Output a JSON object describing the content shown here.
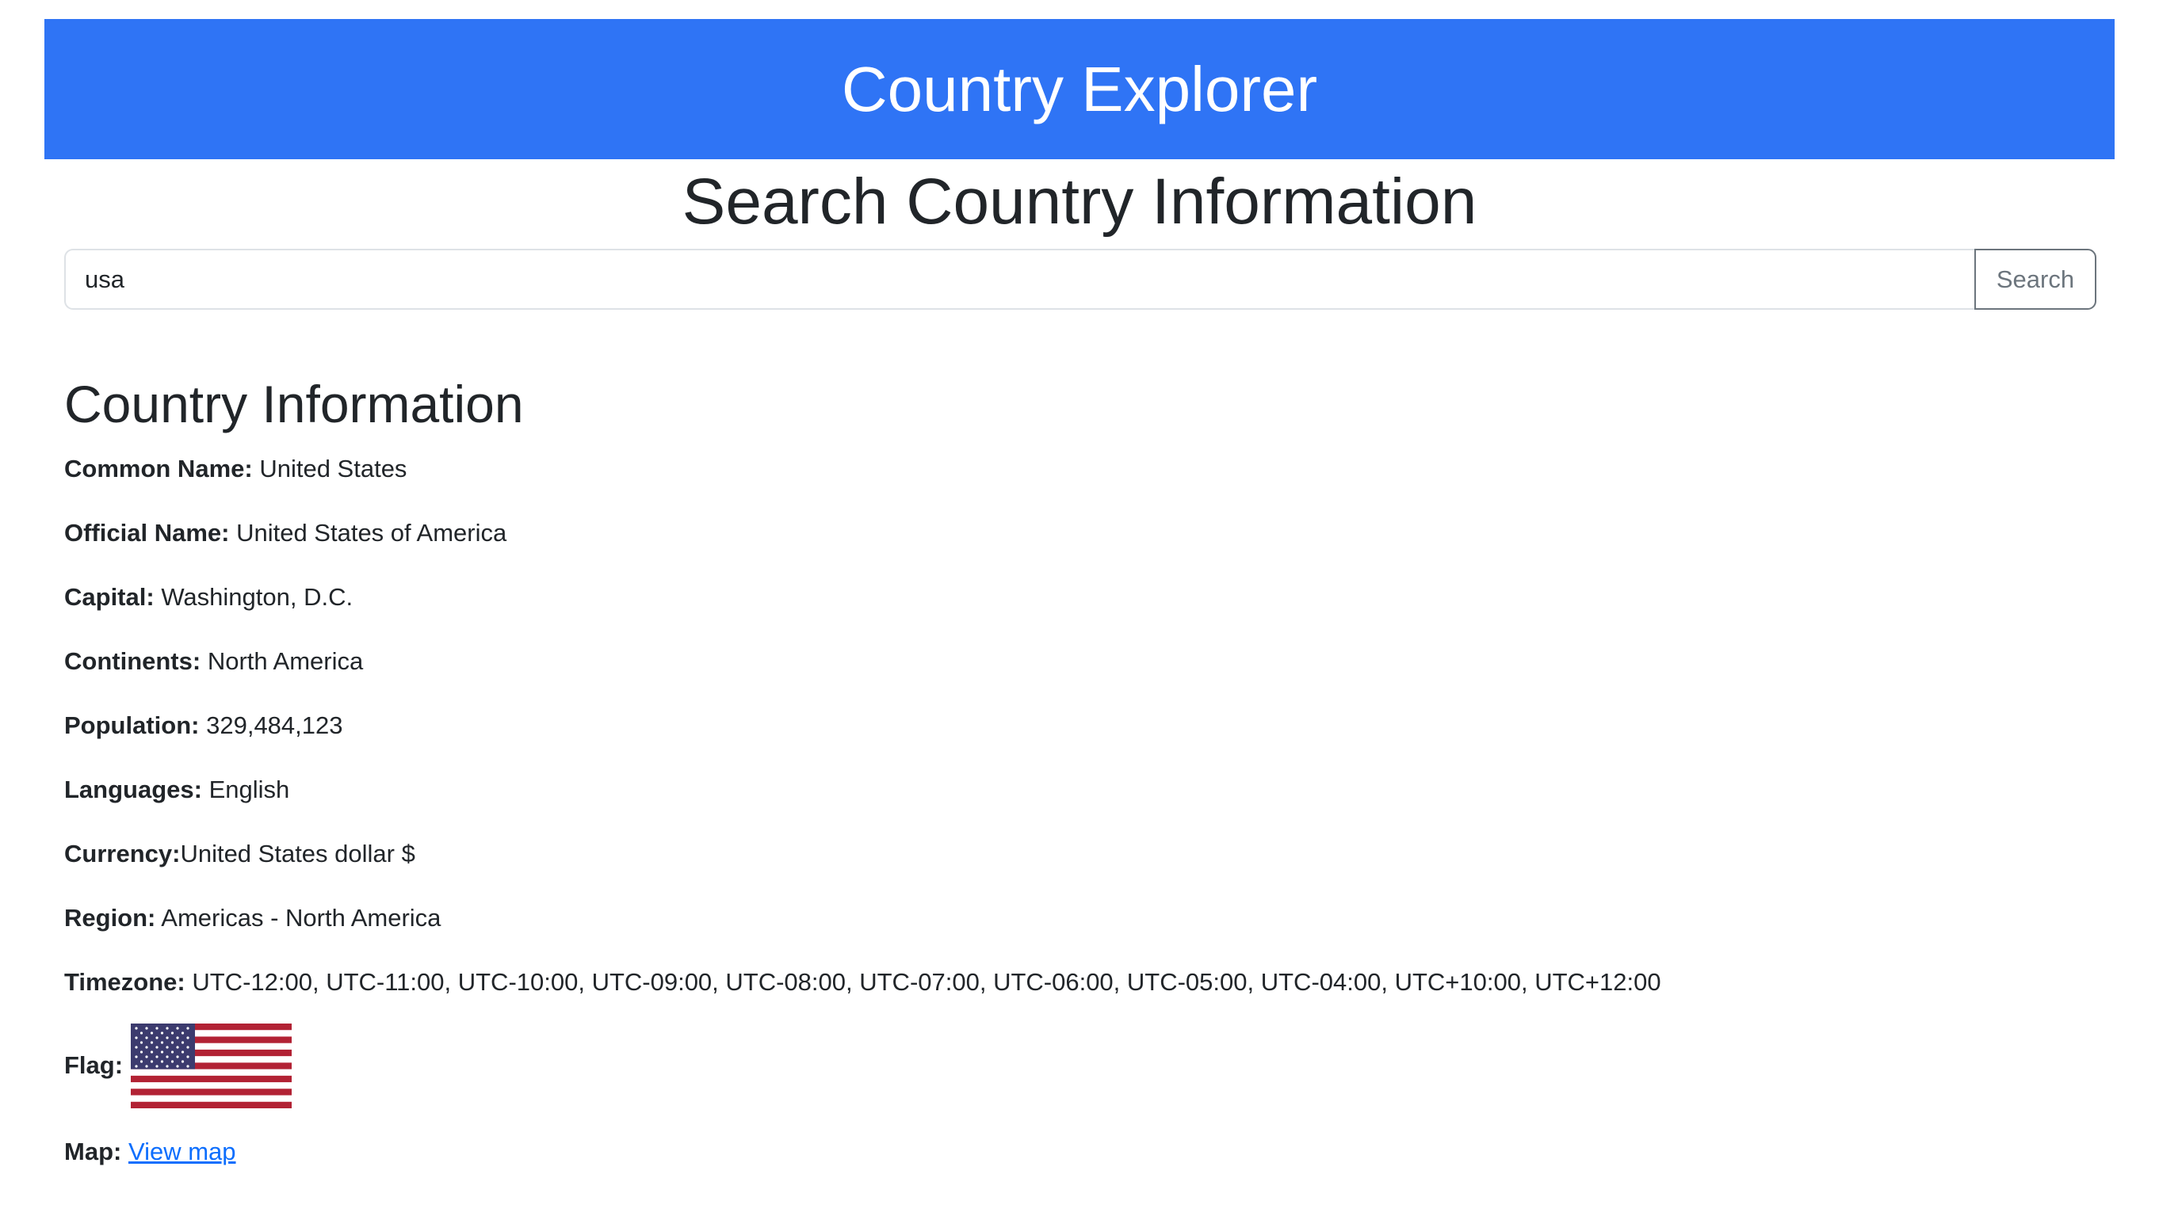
{
  "header": {
    "title": "Country Explorer"
  },
  "search": {
    "heading": "Search Country Information",
    "query": "usa",
    "button_label": "Search"
  },
  "info": {
    "title": "Country Information",
    "common_name": {
      "label": "Common Name:",
      "value": "United States"
    },
    "official_name": {
      "label": "Official Name:",
      "value": "United States of America"
    },
    "capital": {
      "label": "Capital:",
      "value": "Washington, D.C."
    },
    "continents": {
      "label": "Continents:",
      "value": "North America"
    },
    "population": {
      "label": "Population:",
      "value": "329,484,123"
    },
    "languages": {
      "label": "Languages:",
      "value": "English"
    },
    "currency": {
      "label": "Currency:",
      "value": "United States dollar $"
    },
    "region": {
      "label": "Region:",
      "value": "Americas - North America"
    },
    "timezone": {
      "label": "Timezone:",
      "value": "UTC-12:00, UTC-11:00, UTC-10:00, UTC-09:00, UTC-08:00, UTC-07:00, UTC-06:00, UTC-05:00, UTC-04:00, UTC+10:00, UTC+12:00"
    },
    "flag": {
      "label": "Flag:",
      "icon": "us-flag"
    },
    "map": {
      "label": "Map:",
      "link_text": "View map"
    }
  },
  "colors": {
    "header_bg": "#2f74f5",
    "link": "#0d6efd",
    "flag_red": "#b22234",
    "flag_blue": "#3c3b6e"
  }
}
